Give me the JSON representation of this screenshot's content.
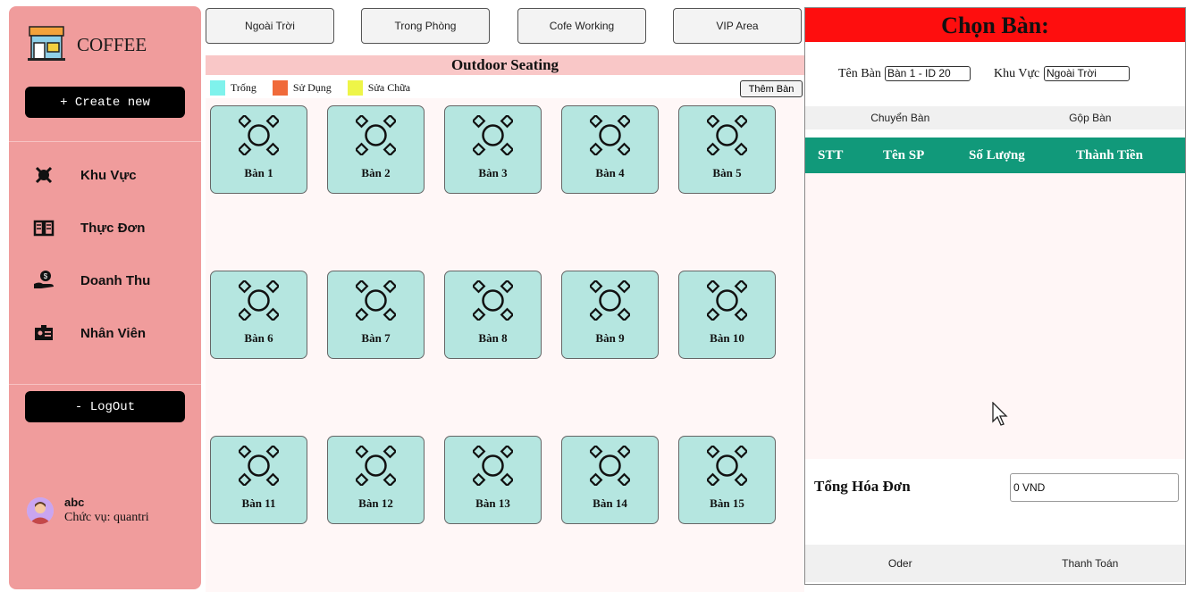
{
  "sidebar": {
    "logo_text": "COFFEE",
    "create_label": "+ Create new",
    "nav": [
      {
        "label": "Khu Vực",
        "icon": "gear-icon"
      },
      {
        "label": "Thực Đơn",
        "icon": "menu-book-icon"
      },
      {
        "label": "Doanh Thu",
        "icon": "revenue-icon"
      },
      {
        "label": "Nhân Viên",
        "icon": "id-card-icon"
      }
    ],
    "logout_label": "- LogOut",
    "user": {
      "name": "abc",
      "role": "Chức vụ: quantri"
    }
  },
  "areas": [
    "Ngoài Trời",
    "Trong Phòng",
    "Cofe Working",
    "VIP Area"
  ],
  "section_title": "Outdoor Seating",
  "legend": [
    {
      "label": "Trống",
      "color": "#7ff2ec"
    },
    {
      "label": "Sử Dụng",
      "color": "#f06a3a"
    },
    {
      "label": "Sửa Chữa",
      "color": "#eef548"
    }
  ],
  "add_table_label": "Thêm Bàn",
  "tables": [
    "Bàn 1",
    "Bàn 2",
    "Bàn 3",
    "Bàn 4",
    "Bàn 5",
    "Bàn 6",
    "Bàn 7",
    "Bàn 8",
    "Bàn 9",
    "Bàn 10",
    "Bàn 11",
    "Bàn 12",
    "Bàn 13",
    "Bàn 14",
    "Bàn 15"
  ],
  "colors": {
    "table_available": "#b5e6e0",
    "header_red": "#fe0e0e",
    "table_head_green": "#11997a",
    "sidebar": "#f09c9c"
  },
  "panel": {
    "title": "Chọn Bàn:",
    "table_name_label": "Tên Bàn",
    "table_name_value": "Bàn 1 - ID 20",
    "area_label": "Khu Vực",
    "area_value": "Ngoài Trời",
    "move_label": "Chuyển Bàn",
    "merge_label": "Gộp Bàn",
    "columns": [
      "STT",
      "Tên SP",
      "Số Lượng",
      "Thành Tiền"
    ],
    "total_label": "Tổng Hóa Đơn",
    "total_value": "0 VND",
    "order_label": "Oder",
    "pay_label": "Thanh Toán"
  }
}
